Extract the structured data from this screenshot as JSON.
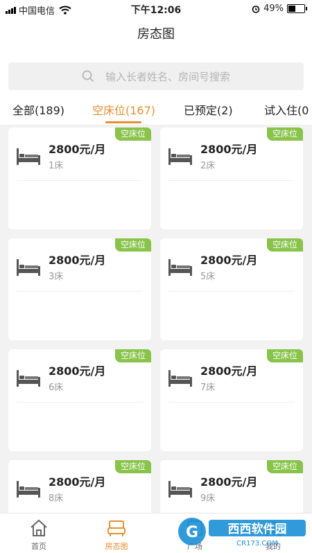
{
  "status": {
    "carrier": "中国电信",
    "time": "下午12:06",
    "battery": "49%",
    "battery_level": 0.49
  },
  "nav": {
    "title": "房态图"
  },
  "search": {
    "placeholder": "输入长者姓名、房间号搜索"
  },
  "tabs": [
    {
      "label": "全部(189)",
      "active": false
    },
    {
      "label": "空床位(167)",
      "active": true
    },
    {
      "label": "已预定(2)",
      "active": false
    },
    {
      "label": "试入住(0",
      "active": false
    }
  ],
  "cards": [
    {
      "badge": "空床位",
      "price": "2800元/月",
      "bed": "1床"
    },
    {
      "badge": "空床位",
      "price": "2800元/月",
      "bed": "2床"
    },
    {
      "badge": "空床位",
      "price": "2800元/月",
      "bed": "3床"
    },
    {
      "badge": "空床位",
      "price": "2800元/月",
      "bed": "5床"
    },
    {
      "badge": "空床位",
      "price": "2800元/月",
      "bed": "6床"
    },
    {
      "badge": "空床位",
      "price": "2800元/月",
      "bed": "7床"
    },
    {
      "badge": "空床位",
      "price": "2800元/月",
      "bed": "8床"
    },
    {
      "badge": "空床位",
      "price": "2800元/月",
      "bed": "9床"
    }
  ],
  "tabbar": [
    {
      "label": "首页",
      "icon": "home-icon",
      "active": false
    },
    {
      "label": "房态图",
      "icon": "bed-icon",
      "active": true
    },
    {
      "label": "广场",
      "icon": "square-icon",
      "active": false
    },
    {
      "label": "我的",
      "icon": "user-icon",
      "active": false
    }
  ],
  "watermark": {
    "text": "西西软件园",
    "sub": "CR173.COM",
    "logo": "G"
  },
  "colors": {
    "accent": "#e98d2f",
    "badge": "#88c34a",
    "background": "#f2f2f2"
  }
}
